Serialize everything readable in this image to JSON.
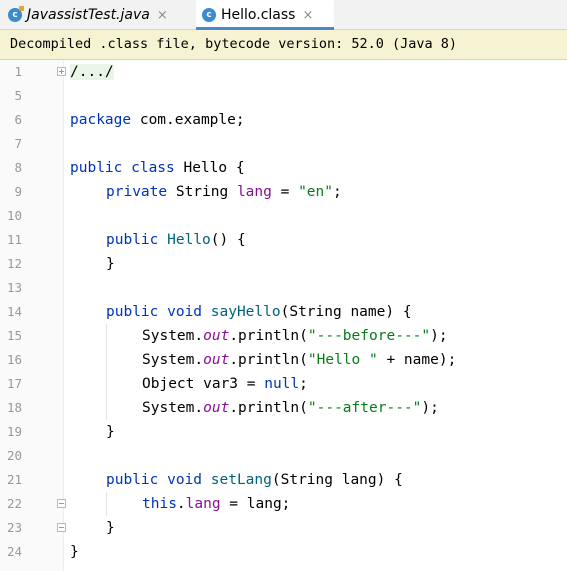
{
  "tabs": [
    {
      "label": "JavassistTest.java",
      "icon": "class-file-icon",
      "active": false
    },
    {
      "label": "Hello.class",
      "icon": "class-file-icon",
      "active": true
    }
  ],
  "tab_close_glyph": "×",
  "class_icon_letter": "c",
  "banner": "Decompiled .class file, bytecode version: 52.0 (Java 8)",
  "line_numbers": [
    "1",
    "5",
    "6",
    "7",
    "8",
    "9",
    "10",
    "11",
    "12",
    "13",
    "14",
    "15",
    "16",
    "17",
    "18",
    "19",
    "20",
    "21",
    "22",
    "23",
    "24"
  ],
  "code": {
    "l1_fold": "/.../",
    "l6_kw": "package",
    "l6_rest": " com.example;",
    "l8_kw": "public class",
    "l8_rest": " Hello {",
    "l9_kw": "private",
    "l9_type": " String ",
    "l9_field": "lang",
    "l9_eq": " = ",
    "l9_str": "\"en\"",
    "l9_end": ";",
    "l11_kw": "public",
    "l11_sp": " ",
    "l11_name": "Hello",
    "l11_rest": "() {",
    "l12": "}",
    "l14_kw": "public void",
    "l14_sp": " ",
    "l14_name": "sayHello",
    "l14_rest": "(String name) {",
    "l15_a": "System.",
    "l15_out": "out",
    "l15_b": ".println(",
    "l15_str": "\"---before---\"",
    "l15_end": ");",
    "l16_a": "System.",
    "l16_out": "out",
    "l16_b": ".println(",
    "l16_str": "\"Hello \"",
    "l16_end": " + name);",
    "l17_a": "Object var3 = ",
    "l17_kw": "null",
    "l17_end": ";",
    "l18_a": "System.",
    "l18_out": "out",
    "l18_b": ".println(",
    "l18_str": "\"---after---\"",
    "l18_end": ");",
    "l19": "}",
    "l21_kw": "public void",
    "l21_sp": " ",
    "l21_name": "setLang",
    "l21_rest": "(String lang) {",
    "l22_kw": "this",
    "l22_dot": ".",
    "l22_field": "lang",
    "l22_rest": " = lang;",
    "l23": "}",
    "l24": "}"
  },
  "colors": {
    "keyword": "#0033b3",
    "string": "#067d17",
    "field": "#871094",
    "method": "#00627a",
    "banner_bg": "#f6f3d2",
    "active_tab_underline": "#4a88c7"
  }
}
